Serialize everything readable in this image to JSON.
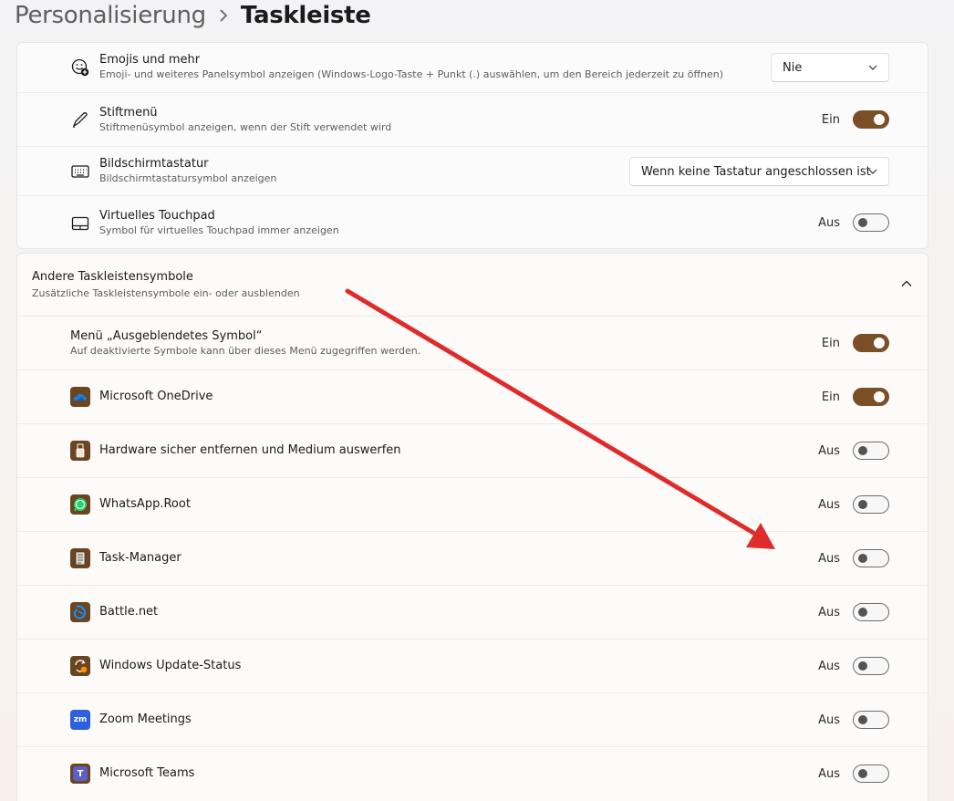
{
  "breadcrumb": {
    "parent": "Personalisierung",
    "current": "Taskleiste"
  },
  "top_rows": [
    {
      "title": "Emojis und mehr",
      "desc": "Emoji- und weiteres Panelsymbol anzeigen (Windows-Logo-Taste + Punkt (.) auswählen, um den Bereich jederzeit zu öffnen)",
      "dropdown": "Nie"
    },
    {
      "title": "Stiftmenü",
      "desc": "Stiftmenüsymbol anzeigen, wenn der Stift verwendet wird",
      "state": "Ein"
    },
    {
      "title": "Bildschirmtastatur",
      "desc": "Bildschirmtastatursymbol anzeigen",
      "dropdown": "Wenn keine Tastatur angeschlossen ist"
    },
    {
      "title": "Virtuelles Touchpad",
      "desc": "Symbol für virtuelles Touchpad immer anzeigen",
      "state": "Aus"
    }
  ],
  "section": {
    "title": "Andere Taskleistensymbole",
    "desc": "Zusätzliche Taskleistensymbole ein- oder ausblenden",
    "hidden_menu": {
      "title": "Menü „Ausgeblendetes Symbol“",
      "desc": "Auf deaktivierte Symbole kann über dieses Menü zugegriffen werden.",
      "state": "Ein"
    },
    "apps": [
      {
        "title": "Microsoft OneDrive",
        "state": "Ein"
      },
      {
        "title": "Hardware sicher entfernen und Medium auswerfen",
        "state": "Aus"
      },
      {
        "title": "WhatsApp.Root",
        "state": "Aus"
      },
      {
        "title": "Task-Manager",
        "state": "Aus"
      },
      {
        "title": "Battle.net",
        "state": "Aus"
      },
      {
        "title": "Windows Update-Status",
        "state": "Aus"
      },
      {
        "title": "Zoom Meetings",
        "state": "Aus"
      },
      {
        "title": "Microsoft Teams",
        "state": "Aus"
      }
    ]
  },
  "icons": {
    "emoji": "emoji-plus-icon",
    "pen": "pen-icon",
    "keyboard": "keyboard-icon",
    "touchpad": "touchpad-icon",
    "onedrive": "onedrive-icon",
    "usb": "usb-drive-icon",
    "whatsapp": "whatsapp-icon",
    "taskmgr": "task-manager-icon",
    "battlenet": "battlenet-icon",
    "update": "windows-update-icon",
    "zoom": "zoom-icon",
    "teams": "teams-icon",
    "zoom_glyph": "zm",
    "teams_glyph": "T"
  },
  "colors": {
    "accent": "#7a4f26",
    "app_icon_bg": "#6b4420",
    "arrow": "#e02b2b"
  }
}
